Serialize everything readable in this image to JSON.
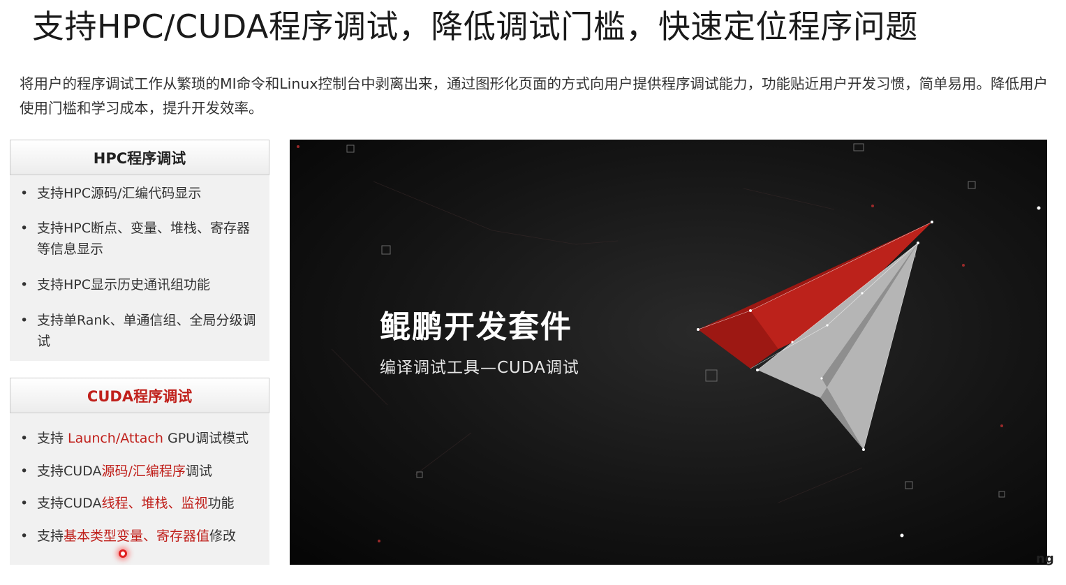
{
  "header": {
    "title": "支持HPC/CUDA程序调试，降低调试门槛，快速定位程序问题",
    "description": "将用户的程序调试工作从繁琐的MI命令和Linux控制台中剥离出来，通过图形化页面的方式向用户提供程序调试能力，功能贴近用户开发习惯，简单易用。降低用户使用门槛和学习成本，提升开发效率。"
  },
  "hpc_panel": {
    "heading": "HPC程序调试",
    "items": [
      "支持HPC源码/汇编代码显示",
      "支持HPC断点、变量、堆栈、寄存器等信息显示",
      "支持HPC显示历史通讯组功能",
      "支持单Rank、单通信组、全局分级调试"
    ]
  },
  "cuda_panel": {
    "heading": "CUDA程序调试",
    "items": [
      {
        "a": "支持 ",
        "b": "Launch/Attach",
        "c": " GPU调试模式"
      },
      {
        "a": "支持CUDA",
        "b": "源码/汇编程序",
        "c": "调试"
      },
      {
        "a": "支持CUDA",
        "b": "线程、堆栈、监视",
        "c": "功能"
      },
      {
        "a": "支持",
        "b": "基本类型变量、寄存器值",
        "c": "修改"
      }
    ]
  },
  "video": {
    "title": "鲲鹏开发套件",
    "subtitle": "编译调试工具—CUDA调试"
  },
  "corner_fragment": "ng",
  "colors": {
    "accent_red": "#c0201b",
    "video_bg": "#141414"
  }
}
